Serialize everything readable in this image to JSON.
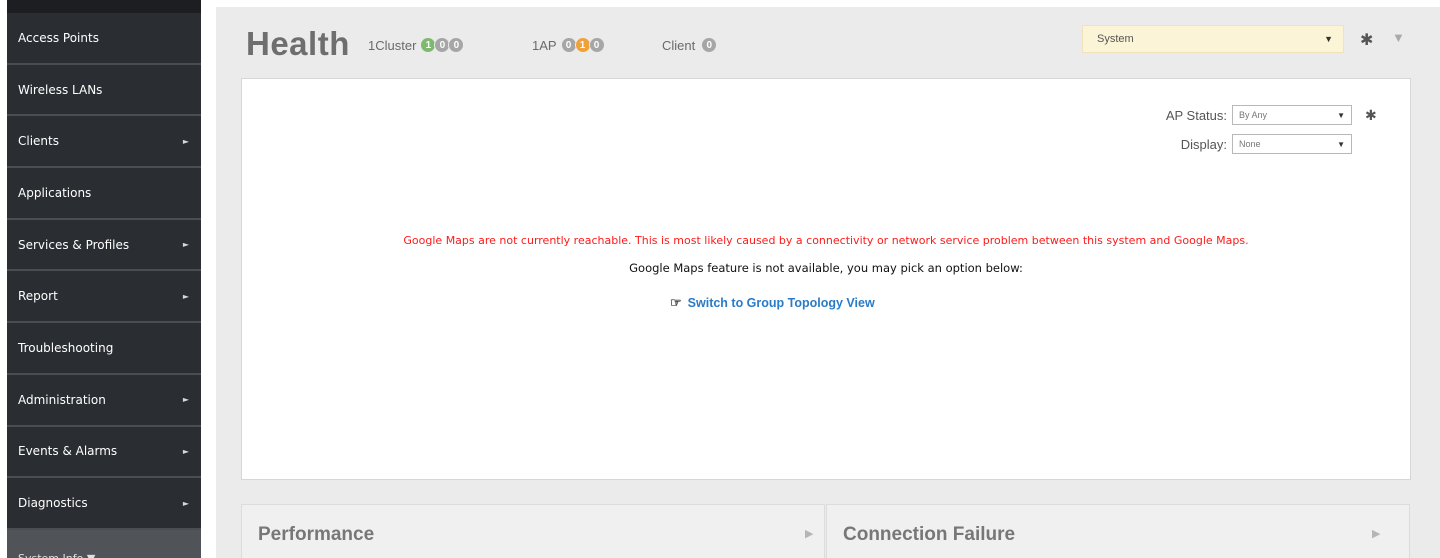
{
  "sidebar": {
    "items": [
      {
        "label": "Access Points",
        "has_arrow": false
      },
      {
        "label": "Wireless LANs",
        "has_arrow": false
      },
      {
        "label": "Clients",
        "has_arrow": true
      },
      {
        "label": "Applications",
        "has_arrow": false
      },
      {
        "label": "Services & Profiles",
        "has_arrow": true
      },
      {
        "label": "Report",
        "has_arrow": true
      },
      {
        "label": "Troubleshooting",
        "has_arrow": false
      },
      {
        "label": "Administration",
        "has_arrow": true
      },
      {
        "label": "Events & Alarms",
        "has_arrow": true
      },
      {
        "label": "Diagnostics",
        "has_arrow": true
      }
    ],
    "arrow_glyph": "►",
    "bottom_label": "System Info ▼"
  },
  "header": {
    "title": "Health",
    "cluster_label": "1Cluster",
    "cluster_counts": [
      "1",
      "0",
      "0"
    ],
    "ap_label": "1AP",
    "ap_counts": [
      "0",
      "1",
      "0"
    ],
    "client_label": "Client",
    "client_counts": [
      "0"
    ],
    "scope_value": "System",
    "gear_icon": "gear-icon",
    "collapse_icon": "triangle-down-icon"
  },
  "map_panel": {
    "ap_status_label": "AP Status:",
    "ap_status_value": "By Any",
    "display_label": "Display:",
    "display_value": "None",
    "error_message": "Google Maps are not currently reachable. This is most likely caused by a connectivity or network service problem between this system and Google Maps.",
    "info_message": "Google Maps feature is not available, you may pick an option below:",
    "switch_link": "Switch to Group Topology View"
  },
  "bottom_panels": {
    "performance": "Performance",
    "connection_failure": "Connection Failure"
  },
  "colors": {
    "green": "#7dba6e",
    "orange": "#f0a13a",
    "gray": "#a6a6a6",
    "error": "#ff1a1a",
    "link": "#2b7bc6",
    "sidebar_bg": "#2a2d31"
  }
}
